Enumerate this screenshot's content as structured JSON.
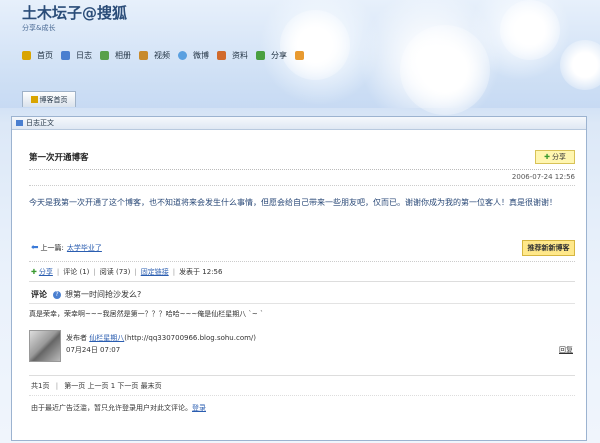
{
  "header": {
    "title": "土木坛子@搜狐",
    "subtitle": "分享&成长"
  },
  "nav": [
    {
      "label": "首页",
      "icon": "home-icon",
      "color": "#d9a400"
    },
    {
      "label": "日志",
      "icon": "book-icon",
      "color": "#4a7fd0"
    },
    {
      "label": "相册",
      "icon": "photo-icon",
      "color": "#58a04a"
    },
    {
      "label": "视频",
      "icon": "film-icon",
      "color": "#c88a2b"
    },
    {
      "label": "微博",
      "icon": "chat-icon",
      "color": "#5aa0e0"
    },
    {
      "label": "资料",
      "icon": "person-icon",
      "color": "#d16a2b"
    },
    {
      "label": "分享",
      "icon": "share-icon",
      "color": "#4aa040"
    },
    {
      "label": "",
      "icon": "mail-icon",
      "color": "#e89a30"
    }
  ],
  "tab": {
    "label": "博客首页"
  },
  "panel": {
    "title": "日志正文"
  },
  "post": {
    "title": "第一次开通博客",
    "share_label": "分享",
    "date": "2006-07-24 12:56",
    "body": "今天是我第一次开通了这个博客，也不知道将来会发生什么事情，但愿会给自己带来一些朋友吧，仅而已。谢谢你成为我的第一位客人！真是很谢谢！",
    "recommend_label": "推荐新新博客",
    "prev_label": "上一篇:",
    "prev_link": "太学毕业了"
  },
  "meta": {
    "share": "分享",
    "comments": "评论 (1)",
    "reads": "阅读 (73)",
    "permalink": "固定链接",
    "published": "发表于 12:56"
  },
  "comments": {
    "label": "评论",
    "prompt": "想第一时间抢沙发么?",
    "items": [
      {
        "text": "真是荣幸，荣幸啊~~~我居然是第一？？？哈哈~~~俺是仙栏星期八 `~ `",
        "by_prefix": "发布者",
        "author": "仙栏星期八",
        "author_url": "(http://qq330700966.blog.sohu.com/)",
        "time": "07月24日 07:07",
        "reply": "回复"
      }
    ]
  },
  "pager": {
    "total": "共1页",
    "links": "第一页 上一页 1 下一页 最末页"
  },
  "notice": {
    "text": "由于最近广告泛滥，暂只允许登录用户对此文评论。",
    "login": "登录"
  }
}
